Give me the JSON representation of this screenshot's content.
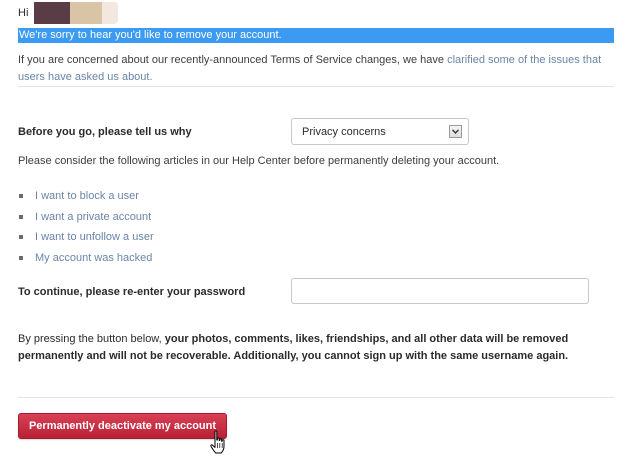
{
  "greeting": {
    "prefix": "Hi"
  },
  "notice": {
    "highlight": "We're sorry to hear you'd like to remove your account.",
    "tos_before": "If you are concerned about our recently-announced Terms of Service changes, we have ",
    "tos_link": "clarified some of the issues that users have asked us about."
  },
  "reason": {
    "label": "Before you go, please tell us why",
    "selected": "Privacy concerns"
  },
  "help": {
    "intro": "Please consider the following articles in our Help Center before permanently deleting your account.",
    "articles": [
      "I want to block a user",
      "I want a private account",
      "I want to unfollow a user",
      "My account was hacked"
    ]
  },
  "password": {
    "label": "To continue, please re-enter your password",
    "value": ""
  },
  "warning": {
    "plain": "By pressing the button below, ",
    "bold": "your photos, comments, likes, friendships, and all other data will be removed permanently and will not be recoverable. Additionally, you cannot sign up with the same username again."
  },
  "action": {
    "deactivate_label": "Permanently deactivate my account"
  },
  "colors": {
    "highlight_bg": "#3b9af2",
    "link": "#6a85a8",
    "danger_button": "#c42d42"
  },
  "icons": {
    "select_arrow": "chevron-down-icon",
    "cursor": "hand-pointer-cursor"
  }
}
